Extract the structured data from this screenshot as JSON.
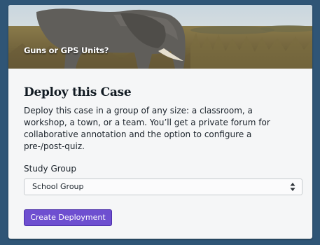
{
  "hero": {
    "title": "Guns or GPS Units?",
    "image_icon": "elephant-photo"
  },
  "deploy": {
    "heading": "Deploy this Case",
    "description": "Deploy this case in a group of any size: a classroom, a workshop, a town, or a team. You’ll get a private forum for collaborative annotation and the option to configure a pre-/post-quiz.",
    "study_group_label": "Study Group",
    "study_group_value": "School Group",
    "select_icon": "updown-chevron-icon",
    "button_label": "Create Deployment"
  },
  "colors": {
    "page_background": "#2f5576",
    "card_background": "#f5f6f7",
    "button_accent": "#6e4fd0"
  }
}
